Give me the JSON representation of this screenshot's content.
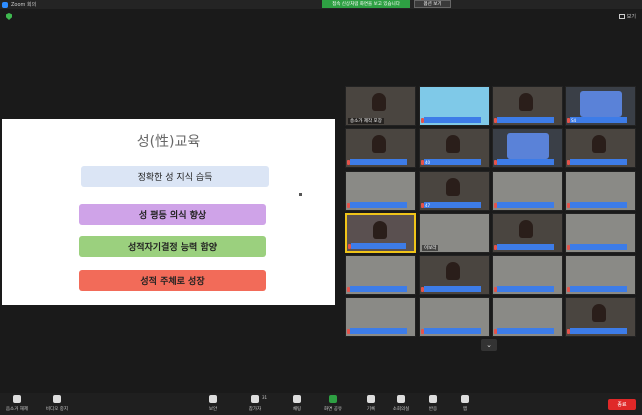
{
  "window": {
    "title": "Zoom 회의"
  },
  "banner": {
    "sharing_notice": "접속 신상처럼 화면을 보고 있습니다",
    "stop_share": "옵션 보기"
  },
  "view_button": {
    "label": "보기"
  },
  "slide": {
    "title": "성(性)교육",
    "items": [
      "정확한 성 지식 습득",
      "성 평등  의식 향상",
      "성적자기결정 능력 함양",
      "성적 주체로 성장"
    ]
  },
  "gallery": {
    "tile_labels": [
      "송소가 제작 포장",
      "",
      "",
      "",
      "",
      "",
      "",
      "",
      "",
      "",
      "",
      "",
      "",
      "이보라",
      "",
      "",
      "",
      "",
      "",
      "",
      "",
      "",
      "",
      "",
      "",
      "",
      "",
      ""
    ],
    "tile_numbers": [
      "",
      "",
      "",
      "S4",
      "",
      "40",
      "",
      "",
      "",
      "47",
      "",
      "",
      "",
      "",
      "",
      "",
      "",
      "",
      "",
      "",
      "",
      "",
      "",
      "",
      "",
      "",
      "",
      ""
    ]
  },
  "toolbar": {
    "items": [
      "음소거 해제",
      "비디오 중지",
      "보안",
      "참가자",
      "채팅",
      "화면 공유",
      "기록",
      "소회의실",
      "반응",
      "앱"
    ],
    "participants_count": "31",
    "end_label": "종료"
  },
  "colors": {
    "share_green": "#2ea043",
    "name_blue": "#3d7ce8",
    "end_red": "#e02828"
  }
}
